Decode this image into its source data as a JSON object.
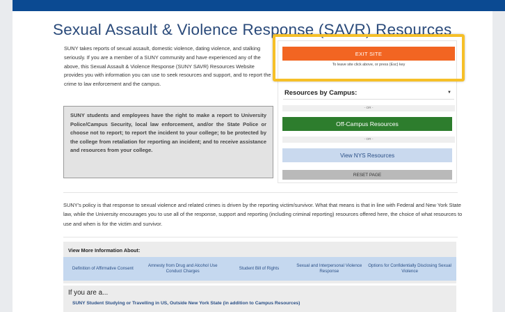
{
  "page": {
    "title": "Sexual Assault & Violence Response (SAVR) Resources",
    "intro": "SUNY takes reports of sexual assault, domestic violence, dating violence, and stalking seriously. If you are a member of a SUNY community and have experienced any of the above, this Sexual Assault & Violence Response (SUNY SAVR) Resources Website provides you with information you can use to seek resources and support, and to report the crime to law enforcement and the campus.",
    "rights": "SUNY students and employees have the right to make a report to University Police/Campus Security, local law enforcement, and/or the State Police or choose not to report; to report the incident to your college; to be protected by the college from retaliation for reporting an incident; and to receive assistance and resources from your college.",
    "policy": "SUNY's policy is that response to sexual violence and related crimes is driven by the reporting victim/survivor. What that means is that in line with Federal and New York State law, while the University encourages you to use all of the response, support and reporting (including criminal reporting) resources offered here, the choice of what resources to use and when is for the victim and survivor."
  },
  "panel": {
    "exit_label": "EXIT SITE",
    "exit_note": "To leave site click above, or press {Esc} key",
    "select_label": "Resources by Campus:",
    "or_label": "- OR -",
    "offcampus_label": "Off-Campus Resources",
    "nys_label": "View NYS Resources",
    "reset_label": "RESET PAGE"
  },
  "more_info": {
    "title": "View More Information About:",
    "links": [
      "Definition of Affirmative Consent",
      "Amnesty from Drug and Alcohol Use Conduct Charges",
      "Student Bill of Rights",
      "Sexual and Interpersonal Violence Response",
      "Options for Confidentially Disclosing Sexual Violence"
    ]
  },
  "if_you_are": {
    "title": "If you are a...",
    "first_link": "SUNY Student Studying or Travelling in US, Outside New York State (in addition to Campus Resources)"
  },
  "colors": {
    "exit": "#f26522",
    "offcampus": "#2d7d2d",
    "nys": "#c9d9ee",
    "highlight": "#f6c028",
    "header": "#0b4a92"
  }
}
